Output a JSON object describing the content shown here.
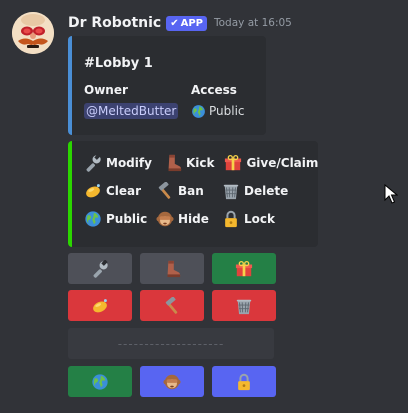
{
  "message": {
    "author": "Dr Robotnic",
    "badge": {
      "check": "✔",
      "label": "APP"
    },
    "timestamp": "Today at 16:05"
  },
  "embed1": {
    "accent": "#4a8fd6",
    "title": "#Lobby 1",
    "fields": {
      "owner": {
        "name": "Owner",
        "value": "@MeltedButter"
      },
      "access": {
        "name": "Access",
        "value": "Public"
      }
    }
  },
  "embed2": {
    "accent": "#2bd600",
    "rows": [
      [
        {
          "icon": "wrench-icon",
          "label": "Modify"
        },
        {
          "icon": "boot-icon",
          "label": "Kick"
        },
        {
          "icon": "gift-icon",
          "label": "Give/Claim"
        }
      ],
      [
        {
          "icon": "soap-icon",
          "label": "Clear"
        },
        {
          "icon": "hammer-icon",
          "label": "Ban"
        },
        {
          "icon": "wastebasket-icon",
          "label": "Delete"
        }
      ],
      [
        {
          "icon": "globe-icon",
          "label": "Public"
        },
        {
          "icon": "see-no-evil-monkey-icon",
          "label": "Hide"
        },
        {
          "icon": "lock-icon",
          "label": "Lock"
        }
      ]
    ]
  },
  "buttons": {
    "row1": [
      {
        "icon": "wrench-icon",
        "style": "grey"
      },
      {
        "icon": "boot-icon",
        "style": "grey"
      },
      {
        "icon": "gift-icon",
        "style": "green"
      }
    ],
    "row2": [
      {
        "icon": "soap-icon",
        "style": "red"
      },
      {
        "icon": "hammer-icon",
        "style": "red"
      },
      {
        "icon": "wastebasket-icon",
        "style": "red"
      }
    ],
    "select_placeholder": "--------------------",
    "row3": [
      {
        "icon": "globe-icon",
        "style": "green"
      },
      {
        "icon": "see-no-evil-monkey-icon",
        "style": "blurple"
      },
      {
        "icon": "lock-icon",
        "style": "blurple"
      }
    ]
  },
  "colors": {
    "background": "#313338",
    "embed_bg": "#2b2d31",
    "grey_button": "#4e5058",
    "green_button": "#248046",
    "red_button": "#da373c",
    "blurple": "#5865f2"
  }
}
